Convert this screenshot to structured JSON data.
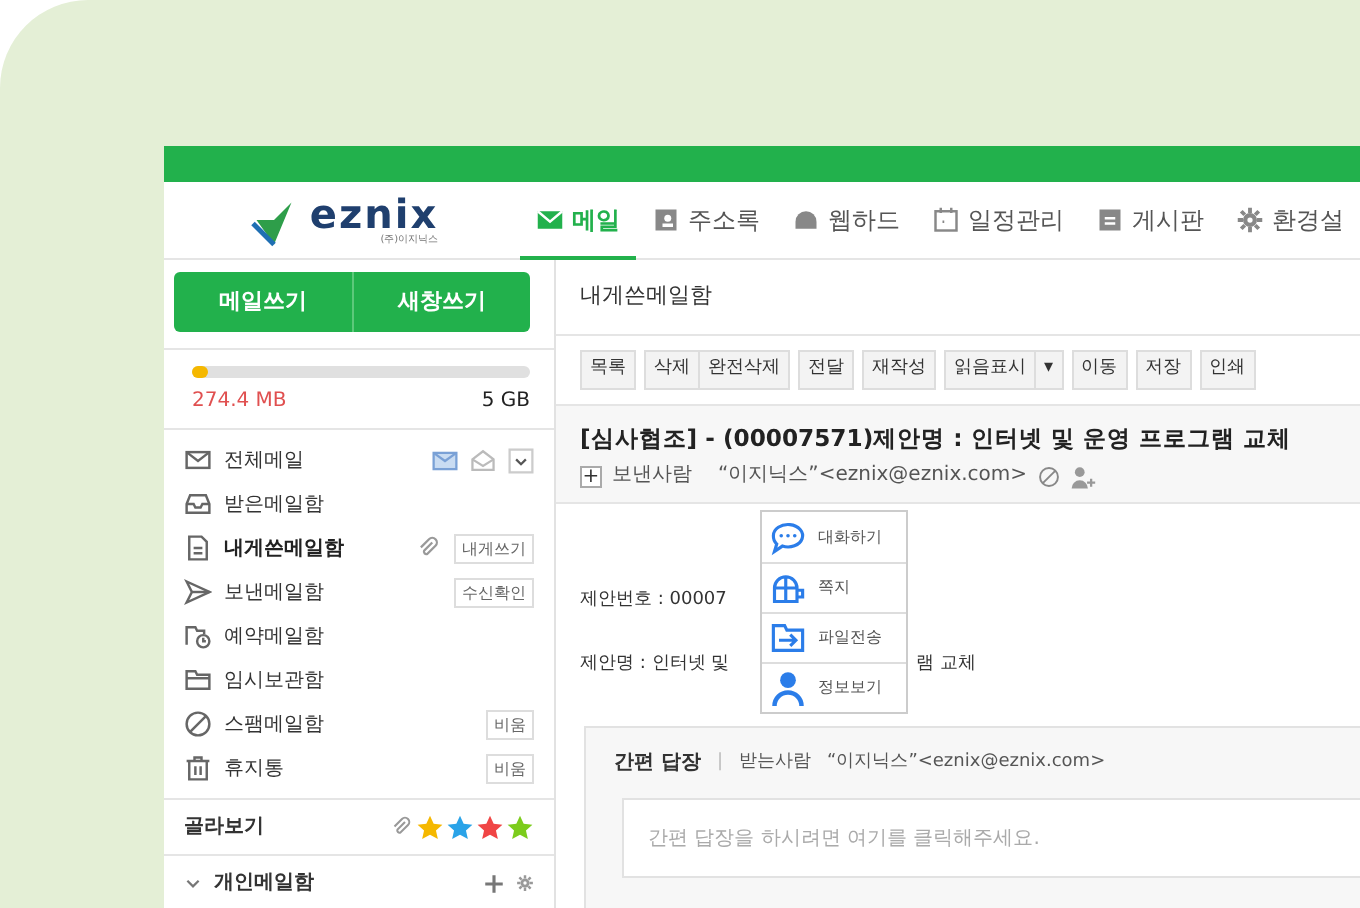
{
  "logo": {
    "name": "eznix",
    "sub": "(주)이지닉스"
  },
  "nav": [
    {
      "label": "메일",
      "selected": true
    },
    {
      "label": "주소록",
      "selected": false
    },
    {
      "label": "웹하드",
      "selected": false
    },
    {
      "label": "일정관리",
      "selected": false
    },
    {
      "label": "게시판",
      "selected": false
    },
    {
      "label": "환경설",
      "selected": false
    }
  ],
  "compose_buttons": [
    "메일쓰기",
    "새창쓰기"
  ],
  "storage": {
    "used": "274.4 MB",
    "total": "5 GB",
    "level": 0.05
  },
  "folders": [
    {
      "name": "전체메일",
      "selected": false
    },
    {
      "name": "받은메일함",
      "selected": false
    },
    {
      "name": "내게쓴메일함",
      "selected": true,
      "tags": [
        "내게쓰기"
      ]
    },
    {
      "name": "보낸메일함",
      "selected": false,
      "tags": [
        "수신확인"
      ]
    },
    {
      "name": "예약메일함",
      "selected": false
    },
    {
      "name": "임시보관함",
      "selected": false
    },
    {
      "name": "스팸메일함",
      "selected": false,
      "tags": [
        "비움"
      ]
    },
    {
      "name": "휴지통",
      "selected": false,
      "tags": [
        "비움"
      ]
    }
  ],
  "filter": {
    "label": "골라보기",
    "stars": [
      {
        "color": "#f5b800"
      },
      {
        "color": "#2aa3e8"
      },
      {
        "color": "#f04545"
      },
      {
        "color": "#7ccc1c"
      }
    ]
  },
  "personal": {
    "label": "개인메일함"
  },
  "folder_title": "내게쓴메일함",
  "toolbar": [
    [
      "목록"
    ],
    [
      "삭제",
      "완전삭제"
    ],
    [
      "전달"
    ],
    [
      "재작성"
    ],
    [
      "읽음표시",
      "▾"
    ],
    [
      "이동"
    ],
    [
      "저장"
    ],
    [
      "인쇄"
    ]
  ],
  "subject": "[심사협조] - (00007571)제안명 : 인터넷 및 운영 프로그램 교체",
  "sender": {
    "expand": "+",
    "label": "보낸사람",
    "value": "“이지닉스”<eznix@eznix.com>"
  },
  "popup": [
    "대화하기",
    "쪽지",
    "파일전송",
    "정보보기"
  ],
  "body": [
    {
      "text": "제안번호 : 00007"
    },
    {
      "text": "제안명 : 인터넷 및",
      "tail": "램 교체"
    }
  ],
  "quick_reply": {
    "title": "간편 답장",
    "separator": "|",
    "to_label": "받는사람",
    "to": "“이지닉스”<eznix@eznix.com>",
    "placeholder": "간편 답장을 하시려면 여기를 클릭해주세요."
  }
}
